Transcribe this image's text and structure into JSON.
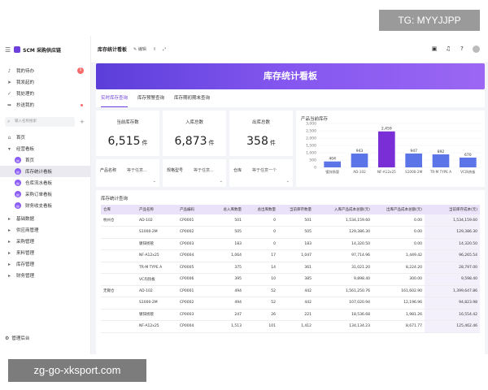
{
  "watermark_top": "TG: MYYJJPP",
  "watermark_bottom": "zg-go-xksport.com",
  "sidebar": {
    "app_name": "SCM 采购供应链",
    "items": [
      {
        "label": "我的待办",
        "badge": "5"
      },
      {
        "label": "我发起的"
      },
      {
        "label": "我处理的"
      },
      {
        "label": "抄送我的"
      }
    ],
    "search_placeholder": "输入名称搜索",
    "nav": [
      {
        "label": "首页"
      },
      {
        "label": "经营看板"
      },
      {
        "label": "首页"
      },
      {
        "label": "库存统计看板"
      },
      {
        "label": "仓库流水看板"
      },
      {
        "label": "采购订单看板"
      },
      {
        "label": "财务收支看板"
      },
      {
        "label": "基础数据"
      },
      {
        "label": "供应商管理"
      },
      {
        "label": "采购管理"
      },
      {
        "label": "来料管理"
      },
      {
        "label": "库存管理"
      },
      {
        "label": "财务管理"
      }
    ],
    "footer": "管理后台"
  },
  "topbar": {
    "title": "库存统计看板",
    "edit": "编辑"
  },
  "banner": "库存统计看板",
  "tabs": [
    "实时库存查询",
    "库存预警查询",
    "库存期初期末查询"
  ],
  "kpis": [
    {
      "label": "当前库存数",
      "value": "6,515",
      "unit": "件"
    },
    {
      "label": "入库总数",
      "value": "6,873",
      "unit": "件"
    },
    {
      "label": "出库总数",
      "value": "358",
      "unit": "件"
    }
  ],
  "filters": [
    {
      "label": "产品名称",
      "placeholder": "等于任意..."
    },
    {
      "label": "规格型号",
      "placeholder": "等于任意..."
    },
    {
      "label": "仓库",
      "placeholder": "等于任意一个"
    }
  ],
  "chart_data": {
    "type": "bar",
    "title": "产品当前库存",
    "categories": [
      "镀锌扬管",
      "AD-102",
      "NF-A12x25",
      "S1000-2M",
      "TR-M TYPE A",
      "VC四热板"
    ],
    "values": [
      404,
      943,
      2459,
      947,
      892,
      670
    ],
    "value_labels": [
      "404",
      "943",
      "2,459",
      "947",
      "892",
      "670"
    ],
    "highlight_index": 2,
    "ylim": [
      0,
      3000
    ],
    "yticks": [
      "3,000",
      "2,500",
      "2,000",
      "1,500",
      "1,000",
      "500",
      "0"
    ],
    "colors": {
      "normal": "#5b74e8",
      "highlight": "#7a2fd6"
    }
  },
  "table": {
    "title": "库存统计查询",
    "columns": [
      "仓库",
      "产品名称",
      "产品编码",
      "总入库数量",
      "总出库数量",
      "当前库存数量",
      "入库产品成本总额(元)",
      "出库产品成本总额(元)",
      "当前库存成本(元)"
    ],
    "rows": [
      [
        "杭州仓",
        "AD-102",
        "CP0001",
        "501",
        "0",
        "501",
        "1,534,159.60",
        "0.00",
        "1,534,159.60"
      ],
      [
        "",
        "S1000-2M",
        "CP0002",
        "505",
        "0",
        "505",
        "129,386.30",
        "0.00",
        "129,386.30"
      ],
      [
        "",
        "镀锌扬管",
        "CP0003",
        "183",
        "0",
        "183",
        "14,320.50",
        "0.00",
        "14,320.50"
      ],
      [
        "",
        "NF-A12x25",
        "CP0004",
        "1,064",
        "17",
        "1,047",
        "97,714.96",
        "1,449.42",
        "96,265.54"
      ],
      [
        "",
        "TR-M TYPE A",
        "CP0005",
        "375",
        "14",
        "361",
        "31,021.20",
        "8,224.20",
        "28,797.00"
      ],
      [
        "",
        "VC均热板",
        "CP0006",
        "395",
        "10",
        "385",
        "9,898.40",
        "300.00",
        "9,598.40"
      ],
      [
        "无锡仓",
        "AD-102",
        "CP0001",
        "494",
        "52",
        "442",
        "1,561,250.76",
        "161,602.90",
        "1,399,647.86"
      ],
      [
        "",
        "S1000-2M",
        "CP0002",
        "494",
        "52",
        "442",
        "107,020.94",
        "12,196.96",
        "94,823.98"
      ],
      [
        "",
        "镀锌扬管",
        "CP0003",
        "247",
        "26",
        "221",
        "18,536.68",
        "1,981.26",
        "16,554.42"
      ],
      [
        "",
        "NF-A12x25",
        "CP0004",
        "1,513",
        "101",
        "1,412",
        "134,134.23",
        "8,671.77",
        "125,462.46"
      ]
    ]
  }
}
